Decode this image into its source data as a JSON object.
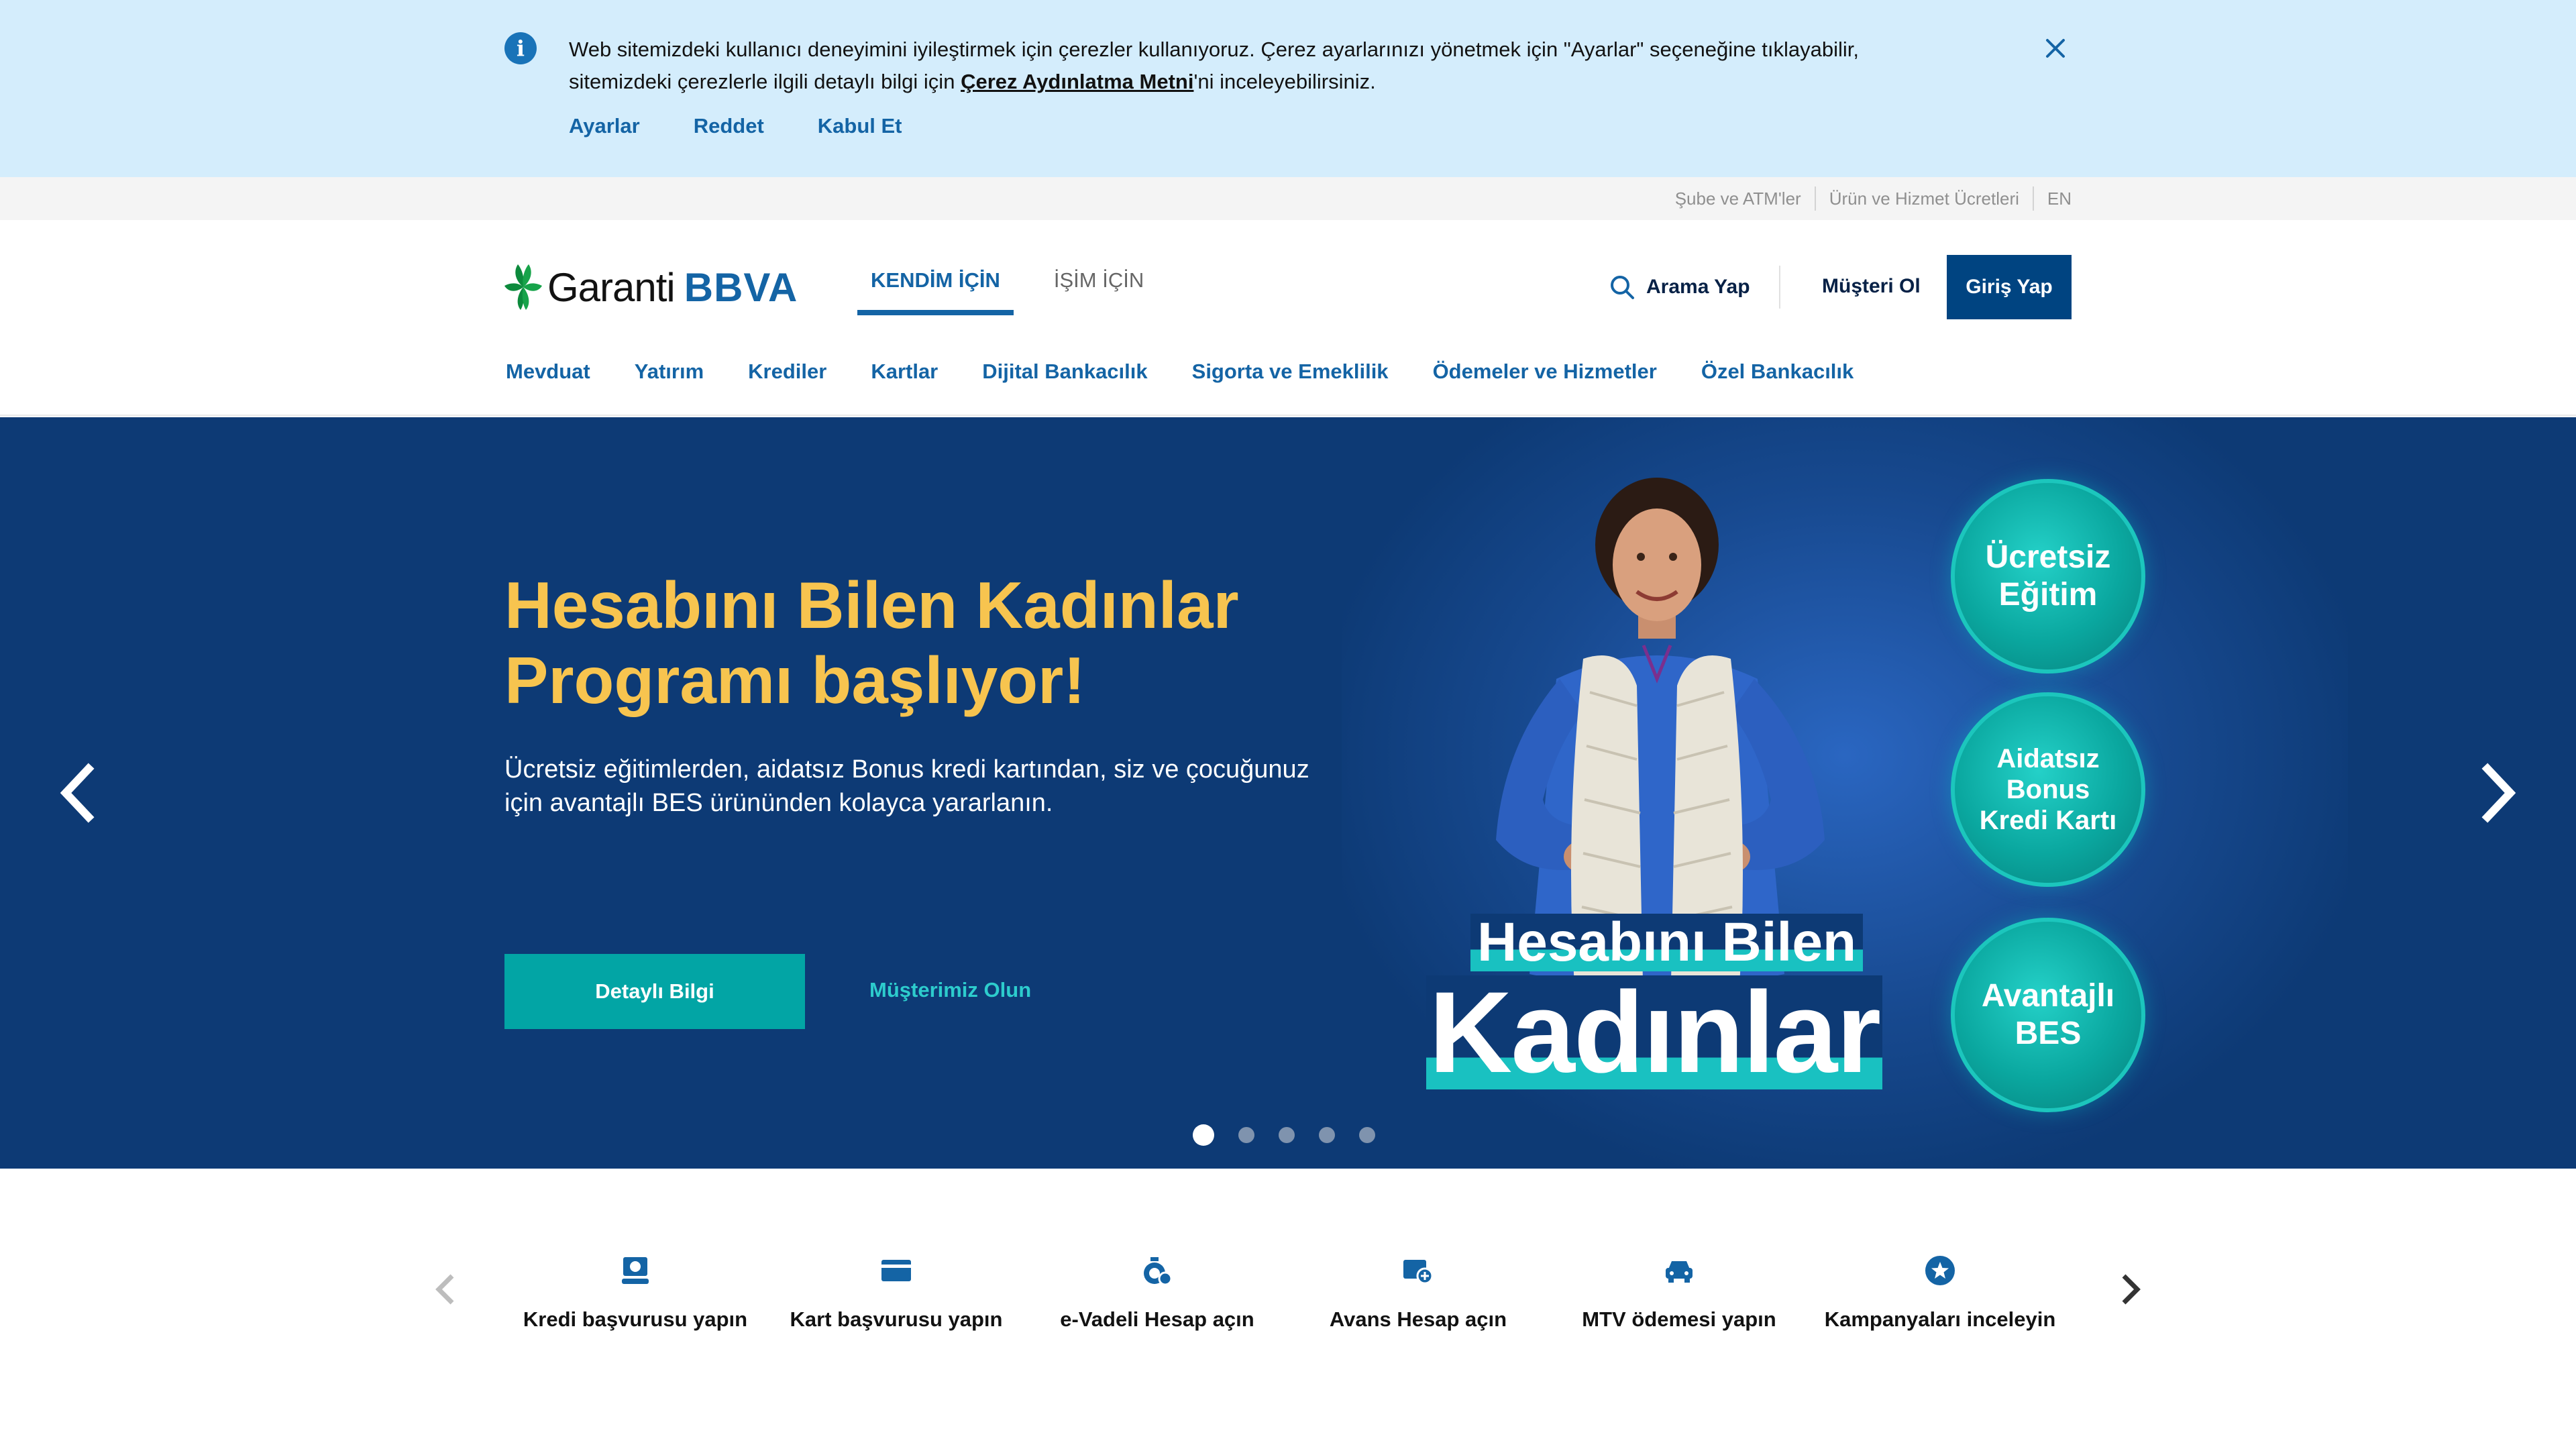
{
  "cookie_banner": {
    "text_line1": "Web sitemizdeki kullanıcı deneyimini iyileştirmek için çerezler kullanıyoruz. Çerez ayarlarınızı yönetmek için \"Ayarlar\" seçeneğine tıklayabilir,",
    "text_line2_before": "sitemizdeki çerezlerle ilgili detaylı bilgi için ",
    "text_link": "Çerez Aydınlatma Metni",
    "text_line2_after": "'ni inceleyebilirsiniz.",
    "actions": [
      "Ayarlar",
      "Reddet",
      "Kabul Et"
    ]
  },
  "utility_links": [
    "Şube ve ATM'ler",
    "Ürün ve Hizmet Ücretleri",
    "EN"
  ],
  "header": {
    "logo_text_1": "Garanti",
    "logo_text_2": "BBVA",
    "audience_tabs": [
      "KENDİM İÇİN",
      "İŞİM İÇİN"
    ],
    "search_label": "Arama Yap",
    "customer_label": "Müşteri Ol",
    "login_label": "Giriş Yap"
  },
  "main_nav": [
    "Mevduat",
    "Yatırım",
    "Krediler",
    "Kartlar",
    "Dijital Bankacılık",
    "Sigorta ve Emeklilik",
    "Ödemeler ve Hizmetler",
    "Özel Bankacılık"
  ],
  "hero": {
    "title_line1": "Hesabını Bilen Kadınlar",
    "title_line2": "Programı başlıyor!",
    "subtitle_line1": "Ücretsiz eğitimlerden, aidatsız Bonus kredi kartından, siz ve çocuğunuz",
    "subtitle_line2": "için avantajlı BES ürününden kolayca yararlanın.",
    "primary_cta": "Detaylı Bilgi",
    "secondary_cta": "Müşterimiz Olun",
    "image_title_line1": "Hesabını Bilen",
    "image_title_line2": "Kadınlar",
    "badges": [
      "Ücretsiz\nEğitim",
      "Aidatsız\nBonus\nKredi Kartı",
      "Avantajlı\nBES"
    ],
    "slide_count": 5,
    "active_slide": 1
  },
  "quick_actions": [
    {
      "label": "Kredi başvurusu yapın",
      "icon": "loan-icon"
    },
    {
      "label": "Kart başvurusu yapın",
      "icon": "card-icon"
    },
    {
      "label": "e-Vadeli Hesap açın",
      "icon": "deposit-icon"
    },
    {
      "label": "Avans Hesap açın",
      "icon": "advance-account-icon"
    },
    {
      "label": "MTV ödemesi yapın",
      "icon": "car-icon"
    },
    {
      "label": "Kampanyaları inceleyin",
      "icon": "star-icon"
    }
  ],
  "colors": {
    "cookie_bg": "#d4edfc",
    "brand_blue": "#1464a5",
    "navy": "#004481",
    "hero_bg": "#0d3a75",
    "hero_title": "#f7c44f",
    "aqua": "#02a5a5"
  }
}
